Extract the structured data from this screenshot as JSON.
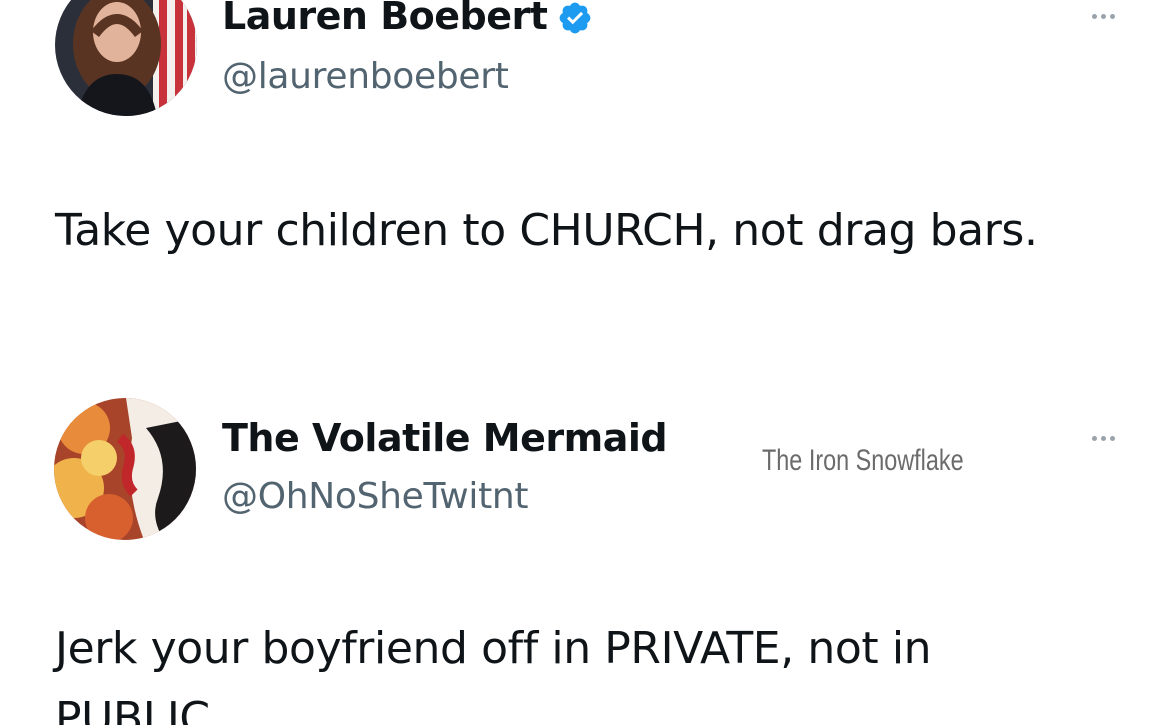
{
  "tweet_main": {
    "display_name": "Lauren Boebert",
    "handle": "@laurenboebert",
    "verified": true,
    "verified_color": "#1d9bf0",
    "text": "Take your children to CHURCH, not drag bars.",
    "more_icon": "more-horizontal-icon"
  },
  "tweet_reply": {
    "display_name": "The Volatile Mermaid",
    "handle": "@OhNoSheTwitnt",
    "text": "Jerk your boyfriend off in PRIVATE, not in PUBLIC.",
    "more_icon": "more-horizontal-icon"
  },
  "watermark": {
    "text": "The Iron Snowflake"
  }
}
